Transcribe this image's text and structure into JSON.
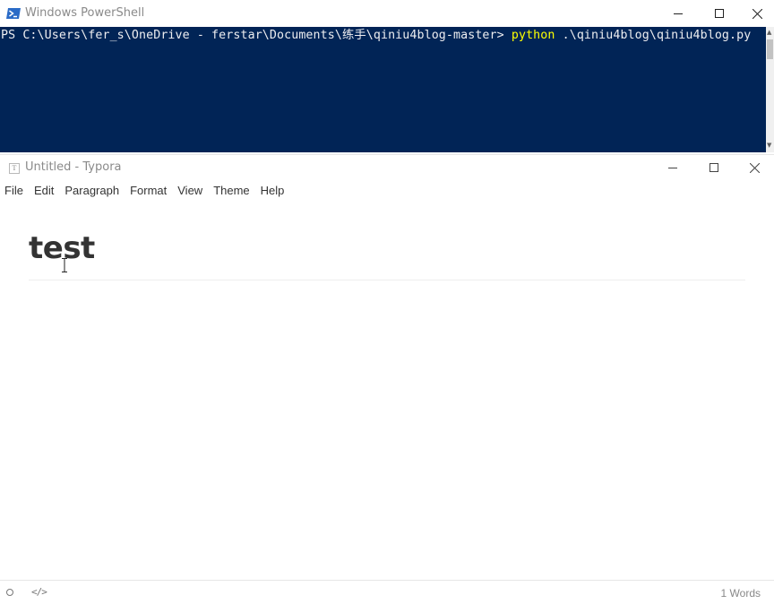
{
  "powershell": {
    "title": "Windows PowerShell",
    "prompt": "PS C:\\Users\\fer_s\\OneDrive - ferstar\\Documents\\练手\\qiniu4blog-master> ",
    "command": "python",
    "args": " .\\qiniu4blog\\qiniu4blog.py",
    "colors": {
      "background": "#012456",
      "text": "#eeedf0",
      "command": "#ffff00"
    },
    "icons": {
      "app": "powershell-icon",
      "minimize": "minimize-icon",
      "maximize": "maximize-icon",
      "close": "close-icon"
    }
  },
  "typora": {
    "title": "Untitled - Typora",
    "app_icon_letter": "T",
    "menu": [
      "File",
      "Edit",
      "Paragraph",
      "Format",
      "View",
      "Theme",
      "Help"
    ],
    "heading": "test",
    "status": {
      "source_code_toggle": "</>",
      "word_count": "1 Words"
    },
    "icons": {
      "app": "typora-icon",
      "minimize": "minimize-icon",
      "maximize": "maximize-icon",
      "close": "close-icon",
      "outline_toggle": "circle-icon",
      "source_mode": "code-icon",
      "text_cursor": "ibeam-cursor-icon"
    }
  }
}
